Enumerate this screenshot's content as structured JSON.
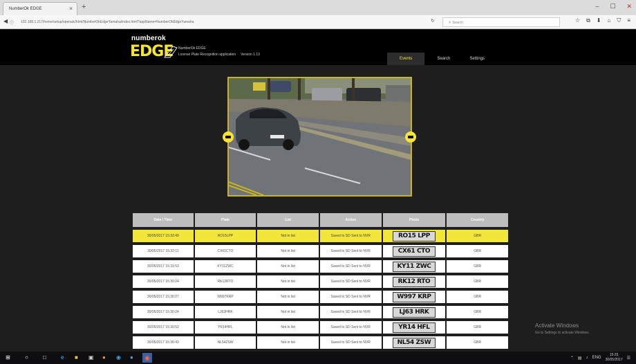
{
  "browser": {
    "tab_title": "NumberOk EDGE",
    "tab_close": "×",
    "new_tab": "+",
    "url": "192.168.1.217/home/setup/openalc/html/NumberOkEdgeYamaha/index.html?appName=NumberOkEdgeYamaha",
    "search_placeholder": "Search",
    "window_controls": [
      "–",
      "☐",
      "✕"
    ],
    "toolbar_icons": [
      "☆",
      "⧉",
      "⬇",
      "⌂",
      "⛉",
      "≡"
    ]
  },
  "app": {
    "logo_small": "numberok",
    "logo_big": "EDGE",
    "product_name": "NumberOk EDGE",
    "description": "License Plate Recognition application",
    "version": "Version 1.13",
    "tabs": [
      {
        "label": "Events",
        "active": true
      },
      {
        "label": "Search",
        "active": false
      },
      {
        "label": "Settings",
        "active": false
      }
    ]
  },
  "table": {
    "headers": [
      "Date / Time",
      "Plate",
      "List",
      "Action",
      "Photo",
      "Country"
    ],
    "rows": [
      {
        "datetime": "30/05/2017 15:32:49",
        "plate": "RO15LPP",
        "list": "Not in list",
        "action": "Saved to SD Sent to NVR",
        "photo_plate": "RO15 LPP",
        "country": "GBR",
        "highlight": true
      },
      {
        "datetime": "30/05/2017 15:32:11",
        "plate": "CX61CTO",
        "list": "Not in list",
        "action": "Saved to SD Sent to NVR",
        "photo_plate": "CX61 CTO",
        "country": "GBR",
        "highlight": false
      },
      {
        "datetime": "30/05/2017 15:31:53",
        "plate": "KY11ZWC",
        "list": "Not in list",
        "action": "Saved to SD Sent to NVR",
        "photo_plate": "KY11 ZWC",
        "country": "GBR",
        "highlight": false
      },
      {
        "datetime": "30/05/2017 15:30:24",
        "plate": "RK12RTO",
        "list": "Not in list",
        "action": "Saved to SD Sent to NVR",
        "photo_plate": "RK12 RTO",
        "country": "GBR",
        "highlight": false
      },
      {
        "datetime": "30/05/2017 15:30:27",
        "plate": "W997KRP",
        "list": "Not in list",
        "action": "Saved to SD Sent to NVR",
        "photo_plate": "W997 KRP",
        "country": "GBR",
        "highlight": false
      },
      {
        "datetime": "30/05/2017 15:30:24",
        "plate": "LJ63HRK",
        "list": "Not in list",
        "action": "Saved to SD Sent to NVR",
        "photo_plate": "LJ63 HRK",
        "country": "GBR",
        "highlight": false
      },
      {
        "datetime": "30/05/2017 15:30:52",
        "plate": "YR14HFL",
        "list": "Not in list",
        "action": "Saved to SD Sent to NVR",
        "photo_plate": "YR14 HFL",
        "country": "GBR",
        "highlight": false
      },
      {
        "datetime": "30/05/2017 15:30:43",
        "plate": "NL54ZSW",
        "list": "Not in list",
        "action": "Saved to SD Sent to NVR",
        "photo_plate": "NL54 ZSW",
        "country": "GBR",
        "highlight": false
      }
    ]
  },
  "watermark": {
    "title": "Activate Windows",
    "subtitle": "Go to Settings to activate Windows."
  },
  "taskbar": {
    "clock_time": "15:33",
    "clock_date": "30/05/2017",
    "language": "ENG"
  },
  "colors": {
    "accent_yellow": "#f5e33a",
    "header_bg": "#000000",
    "page_bg": "#1e1e1e"
  }
}
